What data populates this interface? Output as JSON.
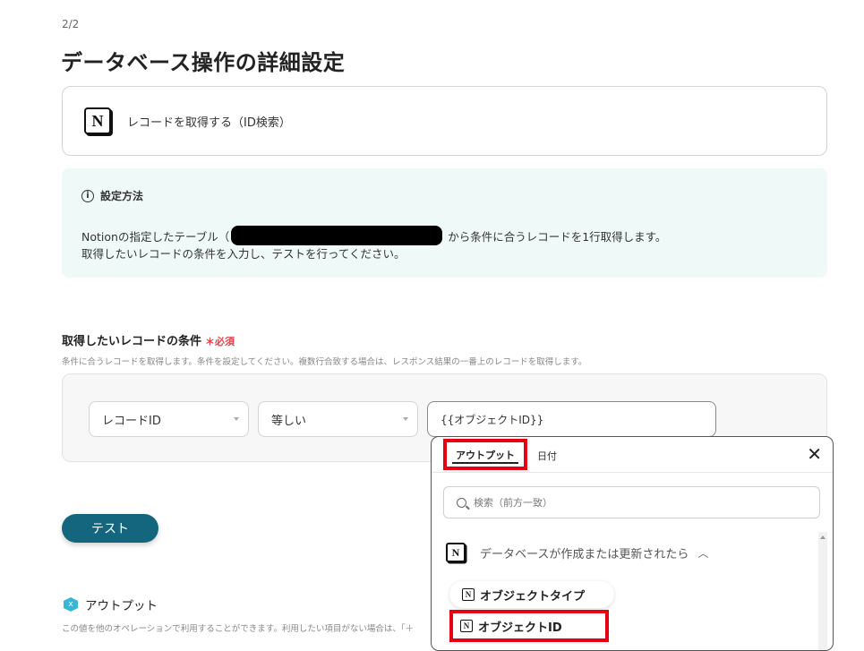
{
  "page": {
    "step": "2/2",
    "title": "データベース操作の詳細設定"
  },
  "action": {
    "icon": "notion-logo-icon",
    "label": "レコードを取得する（ID検索）"
  },
  "info": {
    "heading": "設定方法",
    "line1_prefix": "Notionの指定したテーブル（",
    "line1_suffix": "から条件に合うレコードを1行取得します。",
    "line2": "取得したいレコードの条件を入力し、テストを行ってください。"
  },
  "condition": {
    "label": "取得したいレコードの条件",
    "required": "＊必須",
    "description": "条件に合うレコードを取得します。条件を設定してください。複数行合致する場合は、レスポンス結果の一番上のレコードを取得します。",
    "field": "レコードID",
    "operator": "等しい",
    "value": "{{オブジェクトID}}"
  },
  "test_button": "テスト",
  "output": {
    "heading": "アウトプット",
    "description": "この値を他のオペレーションで利用することができます。利用したい項目がない場合は、「＋"
  },
  "popup": {
    "tabs": [
      "アウトプット",
      "日付"
    ],
    "search_placeholder": "検索（前方一致）",
    "group": "データベースが作成または更新されたら",
    "items": [
      "オブジェクトタイプ",
      "オブジェクトID"
    ]
  },
  "colors": {
    "accent": "#14667f",
    "info_bg": "#effaf8",
    "highlight": "#e60012",
    "required": "#e0434b"
  }
}
